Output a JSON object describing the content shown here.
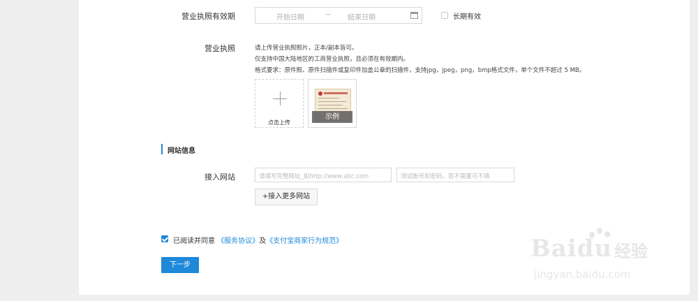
{
  "license_validity": {
    "label": "营业执照有效期",
    "start_placeholder": "开始日期",
    "separator": "~",
    "end_placeholder": "结束日期",
    "long_term_label": "长期有效",
    "long_term_checked": false
  },
  "license": {
    "label": "营业执照",
    "hints": [
      "请上传营业执照照片，正本/副本皆可。",
      "仅支持中国大陆地区的工商营业执照，且必须在有效期内。",
      "格式要求：原件照、原件扫描件或复印件加盖公章的扫描件，支持jpg，jpeg，png，bmp格式文件，单个文件不超过 5 MB。"
    ],
    "upload_label": "点击上传",
    "example_label": "示例"
  },
  "website_section": {
    "title": "网站信息",
    "access_label": "接入网站",
    "url_placeholder": "请填写完整网址_如http://www.abc.com",
    "account_placeholder": "测试账号和密码，若不需要可不填",
    "more_button": "+接入更多网站"
  },
  "agreement": {
    "checked": true,
    "prefix": "已阅读并同意",
    "link1": "《服务协议》",
    "conj": "及",
    "link2": "《支付宝商家行为规范》"
  },
  "next_button": "下一步",
  "watermark": {
    "brand": "Baidu",
    "cn": "经验",
    "url": "jingyan.baidu.com"
  },
  "colors": {
    "accent": "#1e88d9",
    "page_bg": "#eeeeee",
    "panel_bg": "#ffffff"
  }
}
